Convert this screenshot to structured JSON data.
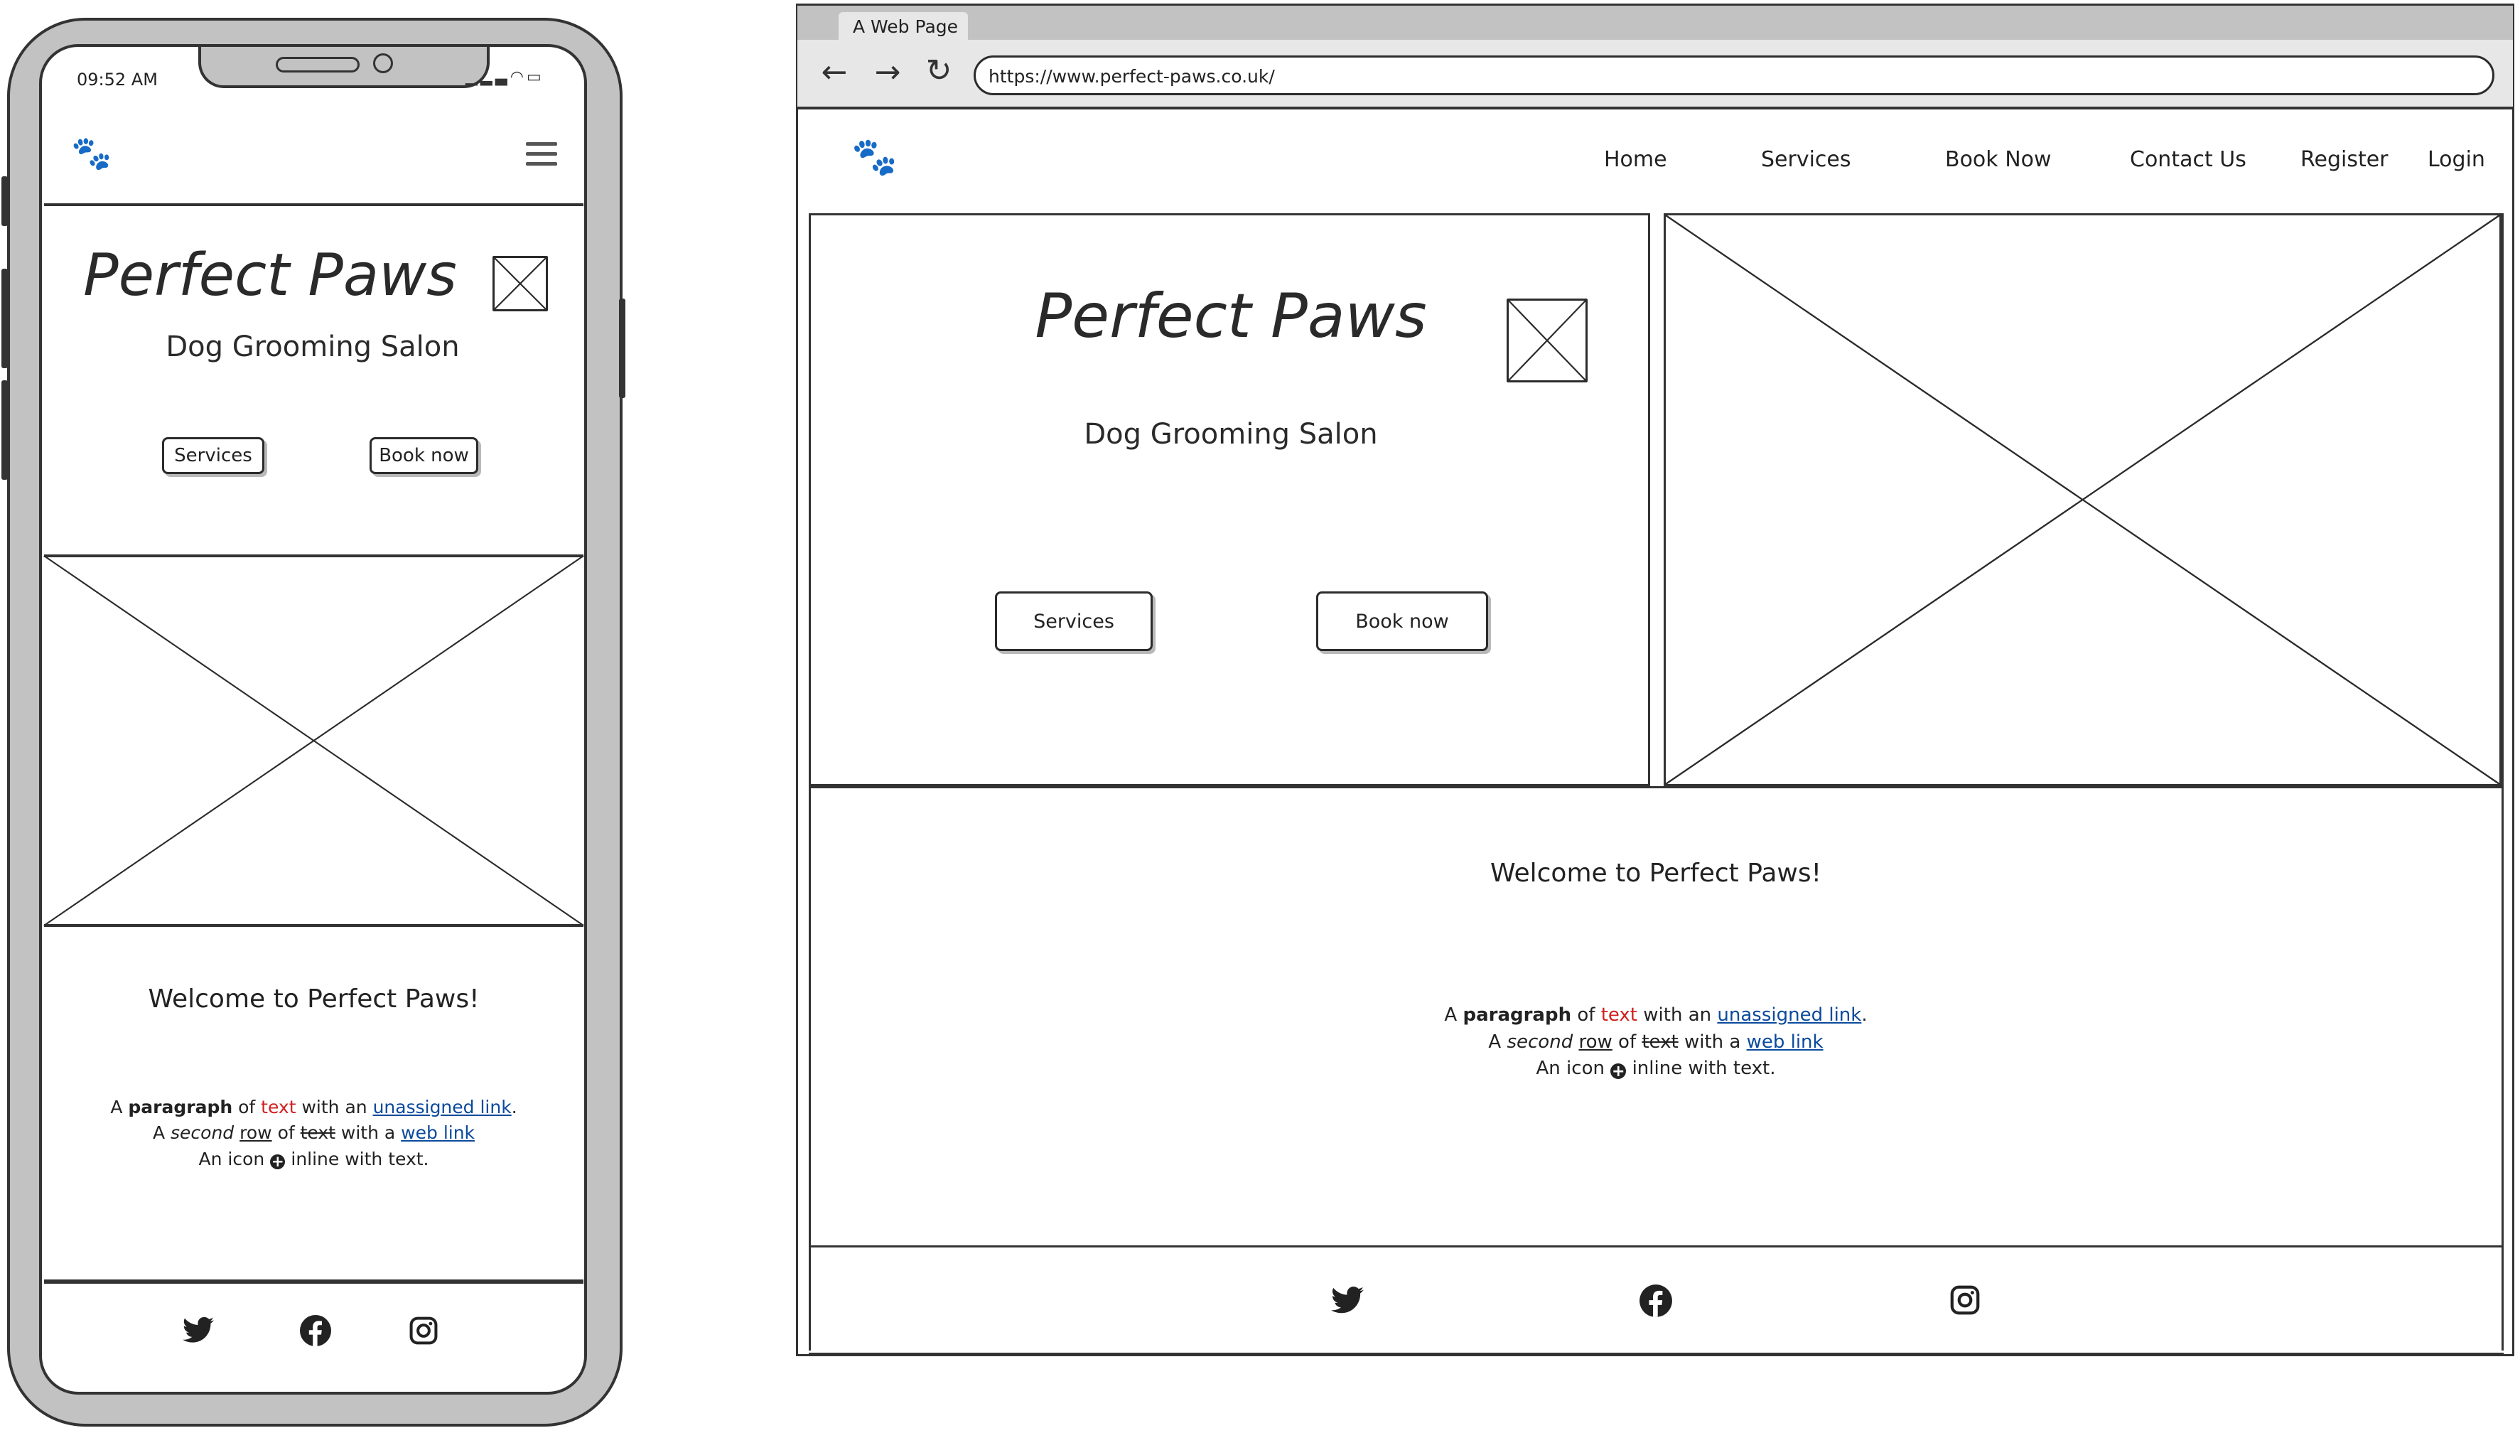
{
  "mobile": {
    "status_time": "09:52 AM",
    "logo_icon": "paw-prints-icon",
    "menu_icon": "hamburger-menu-icon",
    "hero": {
      "title": "Perfect Paws",
      "subtitle": "Dog Grooming Salon",
      "services_button": "Services",
      "book_button": "Book now"
    },
    "welcome": {
      "heading": "Welcome to Perfect Paws!",
      "line1": {
        "a": "A ",
        "bold": "paragraph",
        "of": " of ",
        "red": "text",
        "with": " with an ",
        "link": "unassigned link",
        "end": "."
      },
      "line2": {
        "a": "A ",
        "italic": "second",
        "sp": " ",
        "underline": "row",
        "of": " of ",
        "strike": "text",
        "with": " with a ",
        "link": "web link"
      },
      "line3": {
        "a": "An icon ",
        "icon": "+",
        "end": " inline with text."
      }
    },
    "footer_icons": [
      "twitter-icon",
      "facebook-icon",
      "instagram-icon"
    ]
  },
  "browser": {
    "tab_title": "A Web Page",
    "url": "https://www.perfect-paws.co.uk/",
    "nav": [
      "Home",
      "Services",
      "Book Now",
      "Contact Us",
      "Register",
      "Login"
    ],
    "hero": {
      "title": "Perfect Paws",
      "subtitle": "Dog Grooming Salon",
      "services_button": "Services",
      "book_button": "Book now"
    },
    "welcome": {
      "heading": "Welcome to Perfect Paws!",
      "line1": {
        "a": "A ",
        "bold": "paragraph",
        "of": " of ",
        "red": "text",
        "with": " with an ",
        "link": "unassigned link",
        "end": "."
      },
      "line2": {
        "a": "A ",
        "italic": "second",
        "sp": " ",
        "underline": "row",
        "of": " of ",
        "strike": "text",
        "with": " with a ",
        "link": "web link"
      },
      "line3": {
        "a": "An icon ",
        "icon": "+",
        "end": " inline with text."
      }
    },
    "footer_icons": [
      "twitter-icon",
      "facebook-icon",
      "instagram-icon"
    ]
  },
  "colors": {
    "device_grey": "#c2c2c2",
    "stroke": "#2b2b2b",
    "link": "#0b4a9c",
    "highlight_text": "#d21f1f",
    "logo": "#2e3f66"
  }
}
